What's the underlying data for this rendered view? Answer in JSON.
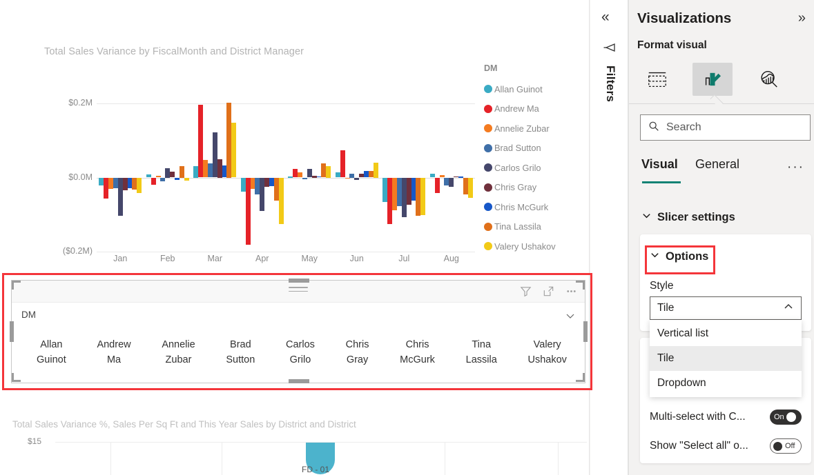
{
  "report": {
    "top_visual": {
      "title": "Total Sales Variance by FiscalMonth and District Manager",
      "legend_title": "DM",
      "y_ticks": [
        "$0.2M",
        "$0.0M",
        "($0.2M)"
      ],
      "x_ticks": [
        "Jan",
        "Feb",
        "Mar",
        "Apr",
        "May",
        "Jun",
        "Jul",
        "Aug"
      ]
    },
    "slicer": {
      "field_label": "DM",
      "caret_icon": "chevron-down-icon",
      "filter_icon": "filter-icon",
      "focus_icon": "focus-mode-icon",
      "more_icon": "more-options-icon",
      "tiles": [
        "Allan\nGuinot",
        "Andrew\nMa",
        "Annelie\nZubar",
        "Brad\nSutton",
        "Carlos\nGrilo",
        "Chris\nGray",
        "Chris\nMcGurk",
        "Tina\nLassila",
        "Valery\nUshakov"
      ]
    },
    "bottom_visual": {
      "title": "Total Sales Variance %, Sales Per Sq Ft and This Year Sales by District and District",
      "y_tick": "$15",
      "bubble_label": "FD - 01"
    }
  },
  "filters_rail": {
    "collapse_icon": "chevrons-left-icon",
    "funnel_icon": "filter-icon",
    "label": "Filters"
  },
  "pane": {
    "title": "Visualizations",
    "expand_icon": "chevrons-right-icon",
    "subtitle": "Format visual",
    "tab_icons": [
      {
        "name": "build-visual-icon",
        "label": "Build visual",
        "selected": false
      },
      {
        "name": "format-visual-icon",
        "label": "Format visual",
        "selected": true
      },
      {
        "name": "analytics-icon",
        "label": "Analytics",
        "selected": false
      }
    ],
    "search": {
      "placeholder": "Search",
      "value": "",
      "icon": "search-icon"
    },
    "subtabs": [
      {
        "label": "Visual",
        "active": true
      },
      {
        "label": "General",
        "active": false
      }
    ],
    "more_label": "···",
    "section": {
      "label": "Slicer settings",
      "expanded": true,
      "icon": "chevron-down-icon"
    },
    "options_card": {
      "label": "Options",
      "expanded": true,
      "icon": "chevron-down-icon",
      "style_label": "Style",
      "style_value": "Tile",
      "style_caret": "chevron-up-icon",
      "style_options": [
        "Vertical list",
        "Tile",
        "Dropdown"
      ],
      "style_selected_index": 1
    },
    "toggles": [
      {
        "label": "Multi-select with C...",
        "state": "On"
      },
      {
        "label": "Show \"Select all\" o...",
        "state": "Off"
      }
    ]
  },
  "colors": {
    "accent_teal": "#118274",
    "annotation_red": "#f4353a",
    "pane_bg": "#f3f2f1",
    "series": [
      {
        "name": "Allan Guinot",
        "hex": "#3aabc4"
      },
      {
        "name": "Andrew Ma",
        "hex": "#e52228"
      },
      {
        "name": "Annelie Zubar",
        "hex": "#f47b20"
      },
      {
        "name": "Brad Sutton",
        "hex": "#3f6fa8"
      },
      {
        "name": "Carlos Grilo",
        "hex": "#45476b"
      },
      {
        "name": "Chris Gray",
        "hex": "#70303c"
      },
      {
        "name": "Chris McGurk",
        "hex": "#1657c8"
      },
      {
        "name": "Tina Lassila",
        "hex": "#e0701a"
      },
      {
        "name": "Valery Ushakov",
        "hex": "#f2ca17"
      }
    ]
  },
  "chart_data": {
    "type": "bar",
    "title": "Total Sales Variance by FiscalMonth and District Manager",
    "xlabel": "FiscalMonth",
    "ylabel": "Total Sales Variance",
    "categories": [
      "Jan",
      "Feb",
      "Mar",
      "Apr",
      "May",
      "Jun",
      "Jul",
      "Aug"
    ],
    "ylim": [
      -0.2,
      0.2
    ],
    "ytick_values": [
      0.2,
      0.0,
      -0.2
    ],
    "ytick_labels": [
      "$0.2M",
      "$0.0M",
      "($0.2M)"
    ],
    "grid": true,
    "legend_position": "right",
    "legend_title": "DM",
    "units": "millions USD",
    "series": [
      {
        "name": "Allan Guinot",
        "color": "#3aabc4",
        "values": [
          -0.022,
          0.009,
          0.03,
          -0.038,
          0.002,
          0.014,
          -0.066,
          0.011
        ]
      },
      {
        "name": "Andrew Ma",
        "color": "#e52228",
        "values": [
          -0.056,
          -0.019,
          0.196,
          -0.182,
          0.023,
          0.073,
          -0.126,
          -0.041
        ]
      },
      {
        "name": "Annelie Zubar",
        "color": "#f47b20",
        "values": [
          -0.031,
          0.004,
          0.047,
          -0.03,
          0.014,
          -0.003,
          -0.088,
          0.006
        ]
      },
      {
        "name": "Brad Sutton",
        "color": "#3f6fa8",
        "values": [
          -0.029,
          -0.011,
          0.039,
          -0.045,
          -0.004,
          0.01,
          -0.078,
          -0.021
        ]
      },
      {
        "name": "Carlos Grilo",
        "color": "#45476b",
        "values": [
          -0.104,
          0.025,
          0.122,
          -0.091,
          0.024,
          -0.006,
          -0.107,
          -0.026
        ]
      },
      {
        "name": "Chris Gray",
        "color": "#70303c",
        "values": [
          -0.034,
          0.016,
          0.05,
          -0.026,
          0.005,
          0.011,
          -0.074,
          0.003
        ]
      },
      {
        "name": "Chris McGurk",
        "color": "#1657c8",
        "values": [
          -0.028,
          -0.007,
          0.033,
          -0.023,
          0.003,
          0.017,
          -0.063,
          0.002
        ]
      },
      {
        "name": "Tina Lassila",
        "color": "#e0701a",
        "values": [
          -0.033,
          0.03,
          0.202,
          -0.062,
          0.038,
          0.018,
          -0.104,
          -0.045
        ]
      },
      {
        "name": "Valery Ushakov",
        "color": "#f2ca17",
        "values": [
          -0.041,
          -0.008,
          0.147,
          -0.125,
          0.03,
          0.04,
          -0.102,
          -0.055
        ]
      }
    ]
  }
}
